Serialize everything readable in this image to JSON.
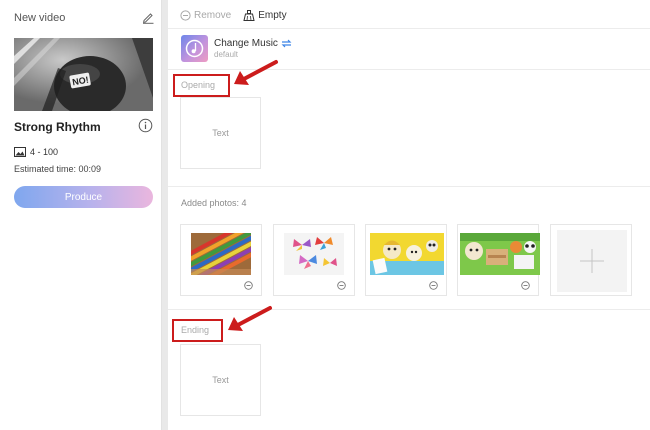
{
  "left_panel": {
    "title": "New video",
    "template_name": "Strong Rhythm",
    "photo_range": "4 - 100",
    "estimated_time": "Estimated time: 00:09",
    "produce_label": "Produce"
  },
  "toolbar": {
    "remove_label": "Remove",
    "empty_label": "Empty"
  },
  "music": {
    "title": "Change Music",
    "subtitle": "default"
  },
  "sections": {
    "opening_label": "Opening",
    "opening_card_text": "Text",
    "added_photos_label": "Added photos: 4",
    "ending_label": "Ending",
    "ending_card_text": "Text"
  },
  "photos": [
    {
      "name": "colored-pencils"
    },
    {
      "name": "paper-butterflies"
    },
    {
      "name": "paper-figures"
    },
    {
      "name": "animal-crafts"
    }
  ],
  "colors": {
    "highlight_red": "#cc1c1c",
    "produce_gradient": [
      "#7fa7ee",
      "#eab6de"
    ],
    "music_gradient": [
      "#6d86ea",
      "#ee9cc2"
    ]
  }
}
